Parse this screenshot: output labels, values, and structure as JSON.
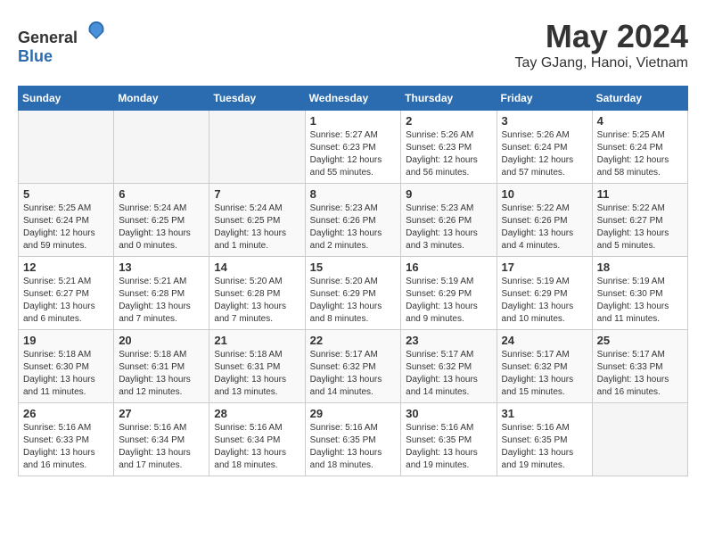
{
  "header": {
    "logo_general": "General",
    "logo_blue": "Blue",
    "title": "May 2024",
    "subtitle": "Tay GJang, Hanoi, Vietnam"
  },
  "calendar": {
    "days_of_week": [
      "Sunday",
      "Monday",
      "Tuesday",
      "Wednesday",
      "Thursday",
      "Friday",
      "Saturday"
    ],
    "weeks": [
      [
        {
          "day": "",
          "info": ""
        },
        {
          "day": "",
          "info": ""
        },
        {
          "day": "",
          "info": ""
        },
        {
          "day": "1",
          "info": "Sunrise: 5:27 AM\nSunset: 6:23 PM\nDaylight: 12 hours\nand 55 minutes."
        },
        {
          "day": "2",
          "info": "Sunrise: 5:26 AM\nSunset: 6:23 PM\nDaylight: 12 hours\nand 56 minutes."
        },
        {
          "day": "3",
          "info": "Sunrise: 5:26 AM\nSunset: 6:24 PM\nDaylight: 12 hours\nand 57 minutes."
        },
        {
          "day": "4",
          "info": "Sunrise: 5:25 AM\nSunset: 6:24 PM\nDaylight: 12 hours\nand 58 minutes."
        }
      ],
      [
        {
          "day": "5",
          "info": "Sunrise: 5:25 AM\nSunset: 6:24 PM\nDaylight: 12 hours\nand 59 minutes."
        },
        {
          "day": "6",
          "info": "Sunrise: 5:24 AM\nSunset: 6:25 PM\nDaylight: 13 hours\nand 0 minutes."
        },
        {
          "day": "7",
          "info": "Sunrise: 5:24 AM\nSunset: 6:25 PM\nDaylight: 13 hours\nand 1 minute."
        },
        {
          "day": "8",
          "info": "Sunrise: 5:23 AM\nSunset: 6:26 PM\nDaylight: 13 hours\nand 2 minutes."
        },
        {
          "day": "9",
          "info": "Sunrise: 5:23 AM\nSunset: 6:26 PM\nDaylight: 13 hours\nand 3 minutes."
        },
        {
          "day": "10",
          "info": "Sunrise: 5:22 AM\nSunset: 6:26 PM\nDaylight: 13 hours\nand 4 minutes."
        },
        {
          "day": "11",
          "info": "Sunrise: 5:22 AM\nSunset: 6:27 PM\nDaylight: 13 hours\nand 5 minutes."
        }
      ],
      [
        {
          "day": "12",
          "info": "Sunrise: 5:21 AM\nSunset: 6:27 PM\nDaylight: 13 hours\nand 6 minutes."
        },
        {
          "day": "13",
          "info": "Sunrise: 5:21 AM\nSunset: 6:28 PM\nDaylight: 13 hours\nand 7 minutes."
        },
        {
          "day": "14",
          "info": "Sunrise: 5:20 AM\nSunset: 6:28 PM\nDaylight: 13 hours\nand 7 minutes."
        },
        {
          "day": "15",
          "info": "Sunrise: 5:20 AM\nSunset: 6:29 PM\nDaylight: 13 hours\nand 8 minutes."
        },
        {
          "day": "16",
          "info": "Sunrise: 5:19 AM\nSunset: 6:29 PM\nDaylight: 13 hours\nand 9 minutes."
        },
        {
          "day": "17",
          "info": "Sunrise: 5:19 AM\nSunset: 6:29 PM\nDaylight: 13 hours\nand 10 minutes."
        },
        {
          "day": "18",
          "info": "Sunrise: 5:19 AM\nSunset: 6:30 PM\nDaylight: 13 hours\nand 11 minutes."
        }
      ],
      [
        {
          "day": "19",
          "info": "Sunrise: 5:18 AM\nSunset: 6:30 PM\nDaylight: 13 hours\nand 11 minutes."
        },
        {
          "day": "20",
          "info": "Sunrise: 5:18 AM\nSunset: 6:31 PM\nDaylight: 13 hours\nand 12 minutes."
        },
        {
          "day": "21",
          "info": "Sunrise: 5:18 AM\nSunset: 6:31 PM\nDaylight: 13 hours\nand 13 minutes."
        },
        {
          "day": "22",
          "info": "Sunrise: 5:17 AM\nSunset: 6:32 PM\nDaylight: 13 hours\nand 14 minutes."
        },
        {
          "day": "23",
          "info": "Sunrise: 5:17 AM\nSunset: 6:32 PM\nDaylight: 13 hours\nand 14 minutes."
        },
        {
          "day": "24",
          "info": "Sunrise: 5:17 AM\nSunset: 6:32 PM\nDaylight: 13 hours\nand 15 minutes."
        },
        {
          "day": "25",
          "info": "Sunrise: 5:17 AM\nSunset: 6:33 PM\nDaylight: 13 hours\nand 16 minutes."
        }
      ],
      [
        {
          "day": "26",
          "info": "Sunrise: 5:16 AM\nSunset: 6:33 PM\nDaylight: 13 hours\nand 16 minutes."
        },
        {
          "day": "27",
          "info": "Sunrise: 5:16 AM\nSunset: 6:34 PM\nDaylight: 13 hours\nand 17 minutes."
        },
        {
          "day": "28",
          "info": "Sunrise: 5:16 AM\nSunset: 6:34 PM\nDaylight: 13 hours\nand 18 minutes."
        },
        {
          "day": "29",
          "info": "Sunrise: 5:16 AM\nSunset: 6:35 PM\nDaylight: 13 hours\nand 18 minutes."
        },
        {
          "day": "30",
          "info": "Sunrise: 5:16 AM\nSunset: 6:35 PM\nDaylight: 13 hours\nand 19 minutes."
        },
        {
          "day": "31",
          "info": "Sunrise: 5:16 AM\nSunset: 6:35 PM\nDaylight: 13 hours\nand 19 minutes."
        },
        {
          "day": "",
          "info": ""
        }
      ]
    ]
  }
}
